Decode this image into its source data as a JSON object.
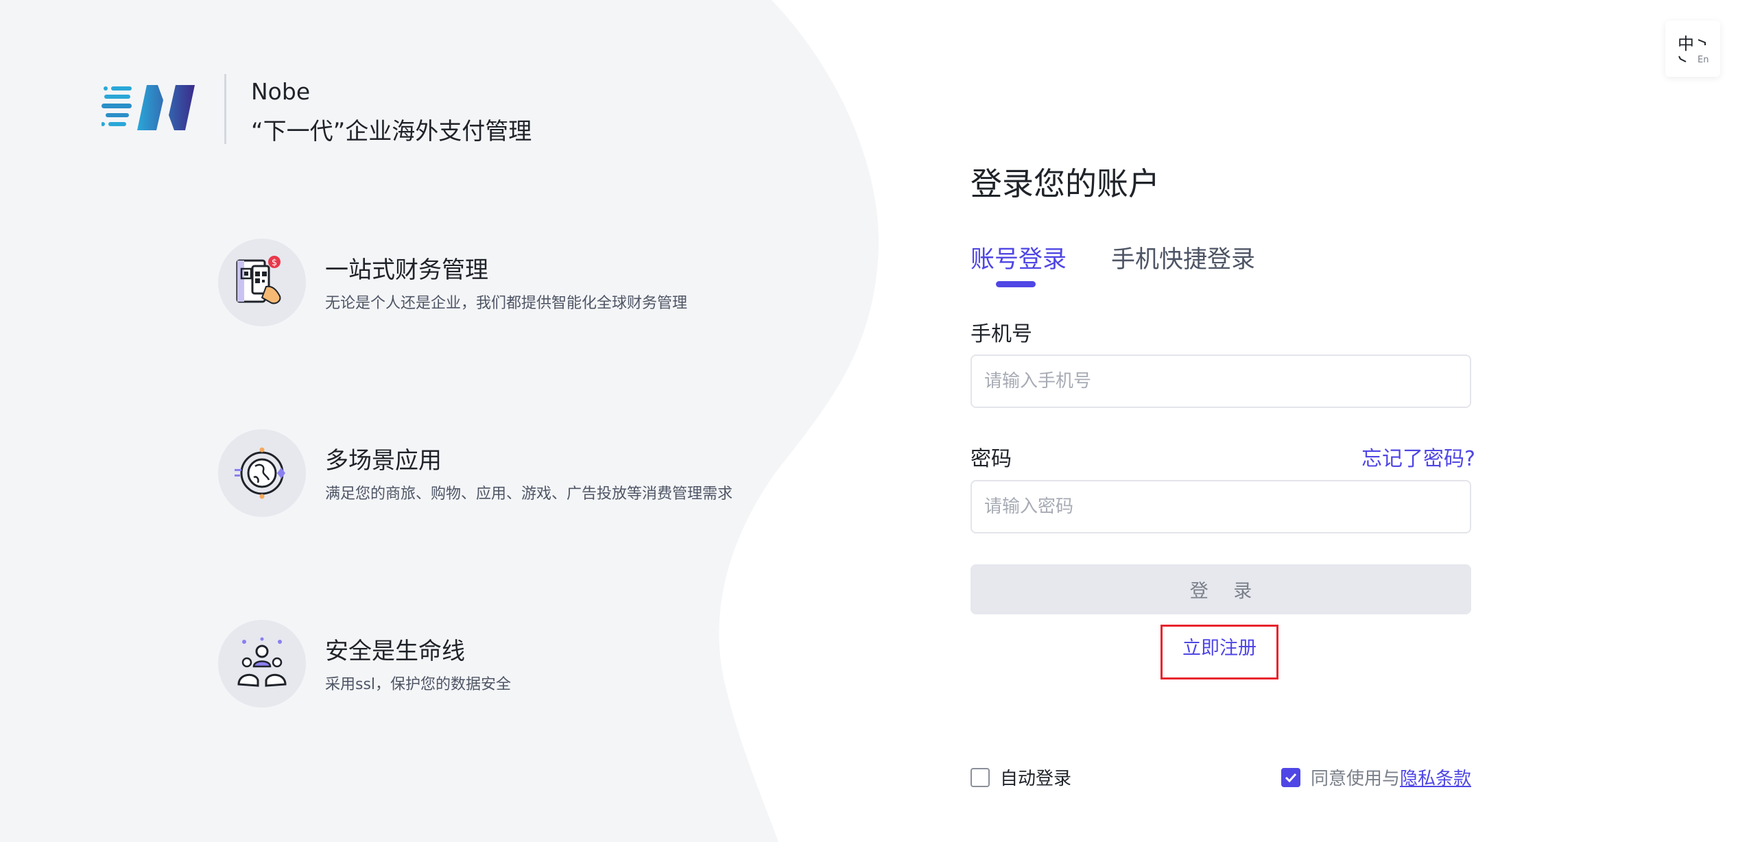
{
  "brand": {
    "name": "Nobe",
    "slogan": "“下一代”企业海外支付管理"
  },
  "features": [
    {
      "title": "一站式财务管理",
      "desc": "无论是个人还是企业，我们都提供智能化全球财务管理",
      "icon": "finance-phone-icon"
    },
    {
      "title": "多场景应用",
      "desc": "满足您的商旅、购物、应用、游戏、广告投放等消费管理需求",
      "icon": "globe-icon"
    },
    {
      "title": "安全是生命线",
      "desc": "采用ssl，保护您的数据安全",
      "icon": "security-team-icon"
    }
  ],
  "lang": {
    "zh": "中",
    "en": "En"
  },
  "login": {
    "title": "登录您的账户",
    "tabs": [
      {
        "label": "账号登录",
        "active": true
      },
      {
        "label": "手机快捷登录",
        "active": false
      }
    ],
    "phone_label": "手机号",
    "phone_placeholder": "请输入手机号",
    "password_label": "密码",
    "forgot": "忘记了密码?",
    "password_placeholder": "请输入密码",
    "submit": "登 录",
    "register": "立即注册",
    "auto_login": {
      "label": "自动登录",
      "checked": false
    },
    "agree": {
      "label": "同意使用与",
      "link": "隐私条款",
      "checked": true
    }
  },
  "colors": {
    "accent": "#4f46e5",
    "highlight": "#e8232c",
    "panel": "#f4f5f7"
  }
}
